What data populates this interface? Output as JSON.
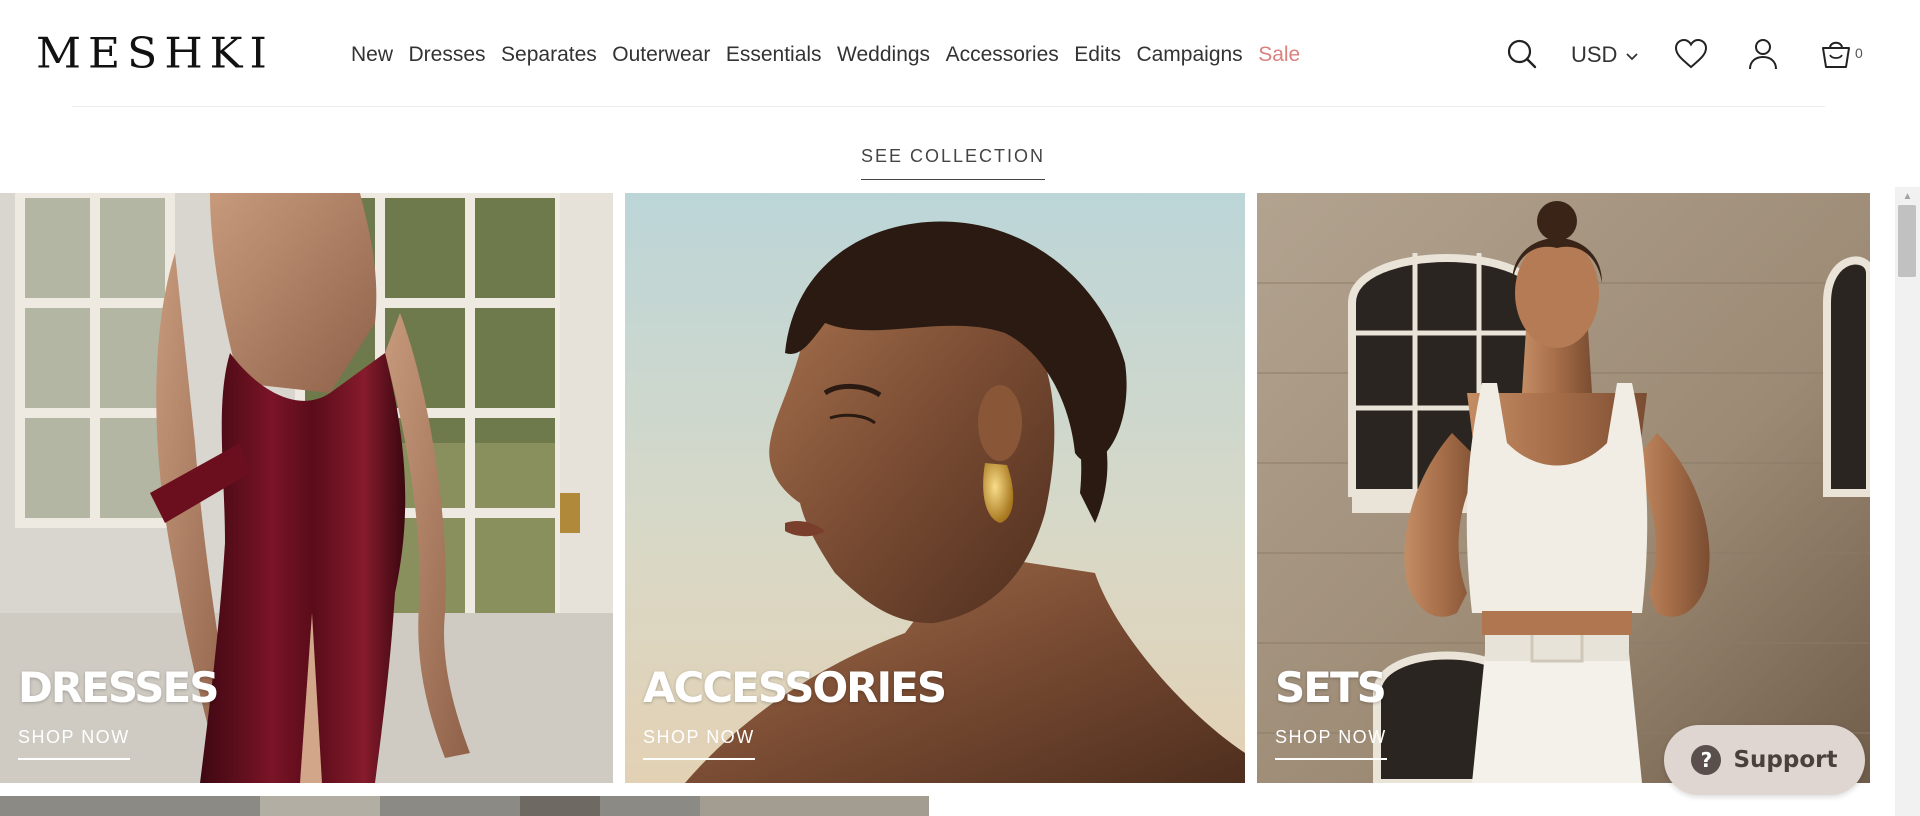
{
  "header": {
    "logo": "MESHKI",
    "nav": [
      {
        "label": "New"
      },
      {
        "label": "Dresses"
      },
      {
        "label": "Separates"
      },
      {
        "label": "Outerwear"
      },
      {
        "label": "Essentials"
      },
      {
        "label": "Weddings"
      },
      {
        "label": "Accessories"
      },
      {
        "label": "Edits"
      },
      {
        "label": "Campaigns"
      },
      {
        "label": "Sale"
      }
    ],
    "currency": "USD",
    "cart_count": "0"
  },
  "see_collection": "SEE COLLECTION",
  "tiles": [
    {
      "title": "DRESSES",
      "cta": "SHOP NOW"
    },
    {
      "title": "ACCESSORIES",
      "cta": "SHOP NOW"
    },
    {
      "title": "SETS",
      "cta": "SHOP NOW"
    }
  ],
  "support": {
    "label": "Support"
  },
  "colors": {
    "sale": "#d9827e",
    "support_bg": "#dfd5d1",
    "dress": "#6b0f1e"
  },
  "icons": [
    "search-icon",
    "chevron-down-icon",
    "heart-icon",
    "user-icon",
    "cart-icon",
    "question-icon"
  ]
}
